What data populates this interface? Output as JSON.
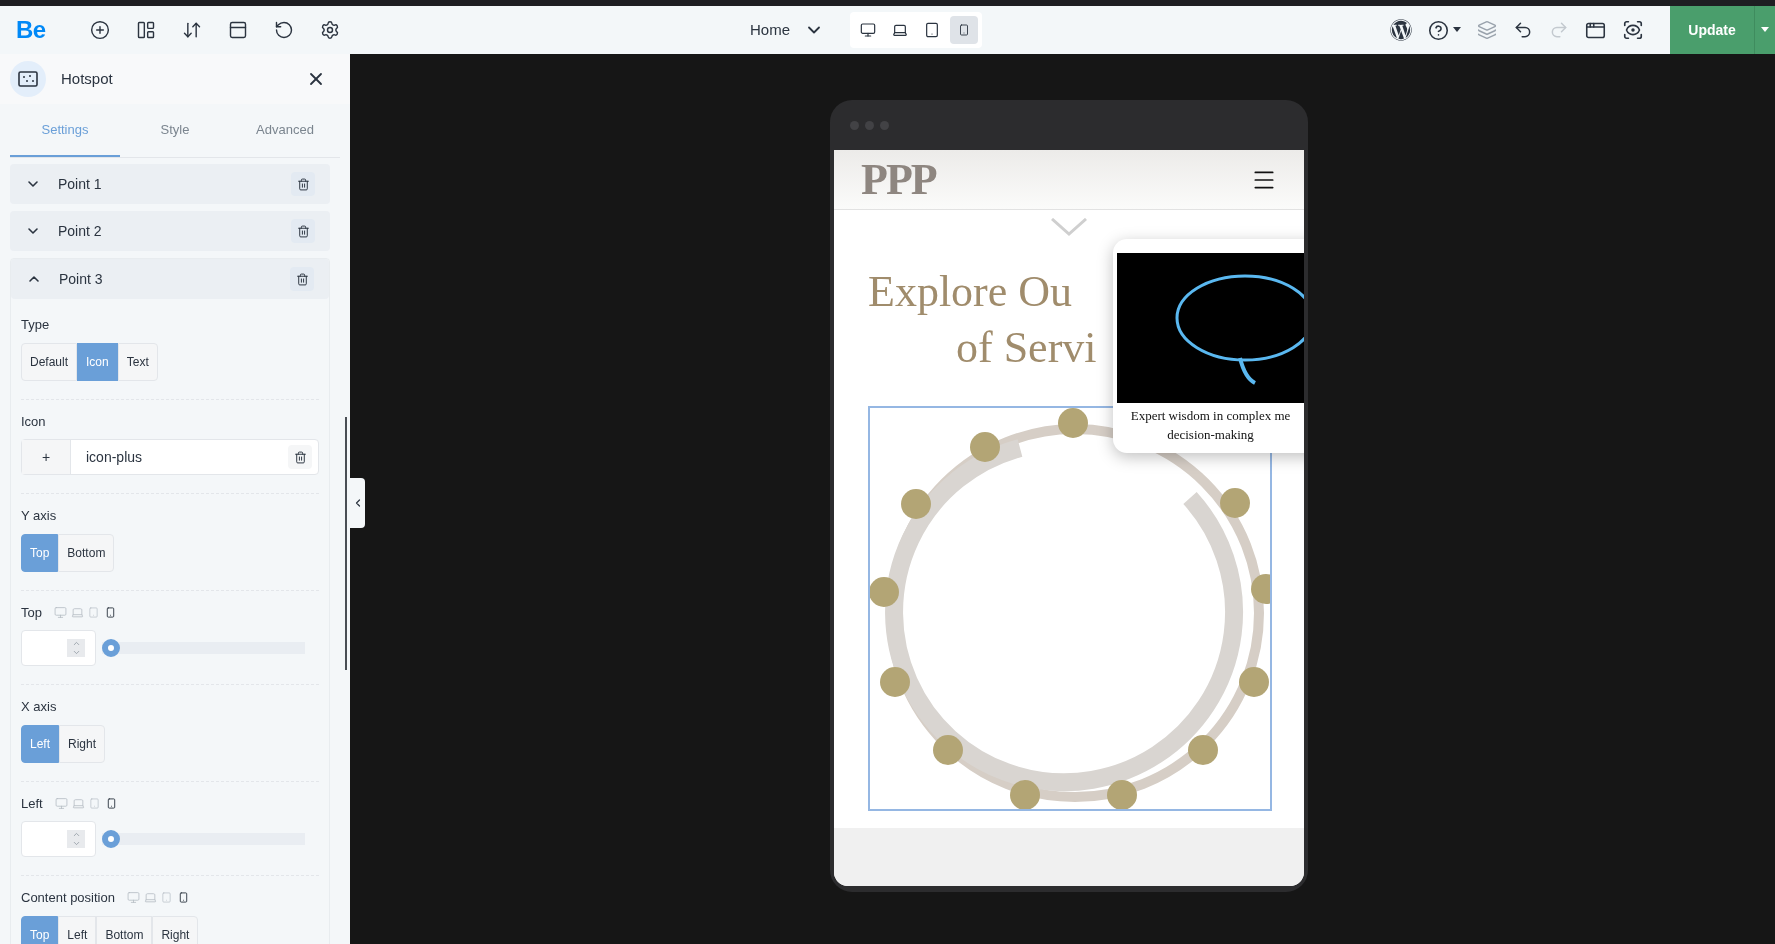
{
  "topbar": {
    "logo": "Be",
    "page": "Home",
    "devices": [
      {
        "kind": "desktop",
        "selected": false
      },
      {
        "kind": "laptop",
        "selected": false
      },
      {
        "kind": "tablet",
        "selected": false
      },
      {
        "kind": "mobile",
        "selected": true
      }
    ],
    "update_button": "Update"
  },
  "panel": {
    "title": "Hotspot",
    "tabs": [
      {
        "label": "Settings",
        "selected": true
      },
      {
        "label": "Style",
        "selected": false
      },
      {
        "label": "Advanced",
        "selected": false
      }
    ],
    "points": [
      {
        "label": "Point 1",
        "expanded": false
      },
      {
        "label": "Point 2",
        "expanded": false
      },
      {
        "label": "Point 3",
        "expanded": true
      }
    ],
    "fields": [
      {
        "kind": "segmented",
        "label": "Type",
        "responsive": false,
        "options": [
          {
            "label": "Default",
            "selected": false
          },
          {
            "label": "Icon",
            "selected": true
          },
          {
            "label": "Text",
            "selected": false
          }
        ]
      },
      {
        "kind": "icon",
        "label": "Icon",
        "symbol": "+",
        "value": "icon-plus"
      },
      {
        "kind": "segmented",
        "label": "Y axis",
        "responsive": false,
        "options": [
          {
            "label": "Top",
            "selected": true
          },
          {
            "label": "Bottom",
            "selected": false
          }
        ]
      },
      {
        "kind": "slider",
        "label": "Top",
        "responsive": true,
        "level": 0
      },
      {
        "kind": "segmented",
        "label": "X axis",
        "responsive": false,
        "options": [
          {
            "label": "Left",
            "selected": true
          },
          {
            "label": "Right",
            "selected": false
          }
        ]
      },
      {
        "kind": "slider",
        "label": "Left",
        "responsive": true,
        "level": 0
      },
      {
        "kind": "segmented",
        "label": "Content position",
        "responsive": true,
        "options": [
          {
            "label": "Top",
            "selected": true
          },
          {
            "label": "Left",
            "selected": false
          },
          {
            "label": "Bottom",
            "selected": false
          },
          {
            "label": "Right",
            "selected": false
          }
        ]
      }
    ]
  },
  "preview": {
    "logo": "PPP",
    "heading": [
      "Explore Ou",
      "of Servi"
    ],
    "popup": {
      "caption": [
        "Expert wisdom in complex me",
        "decision-making"
      ]
    }
  }
}
